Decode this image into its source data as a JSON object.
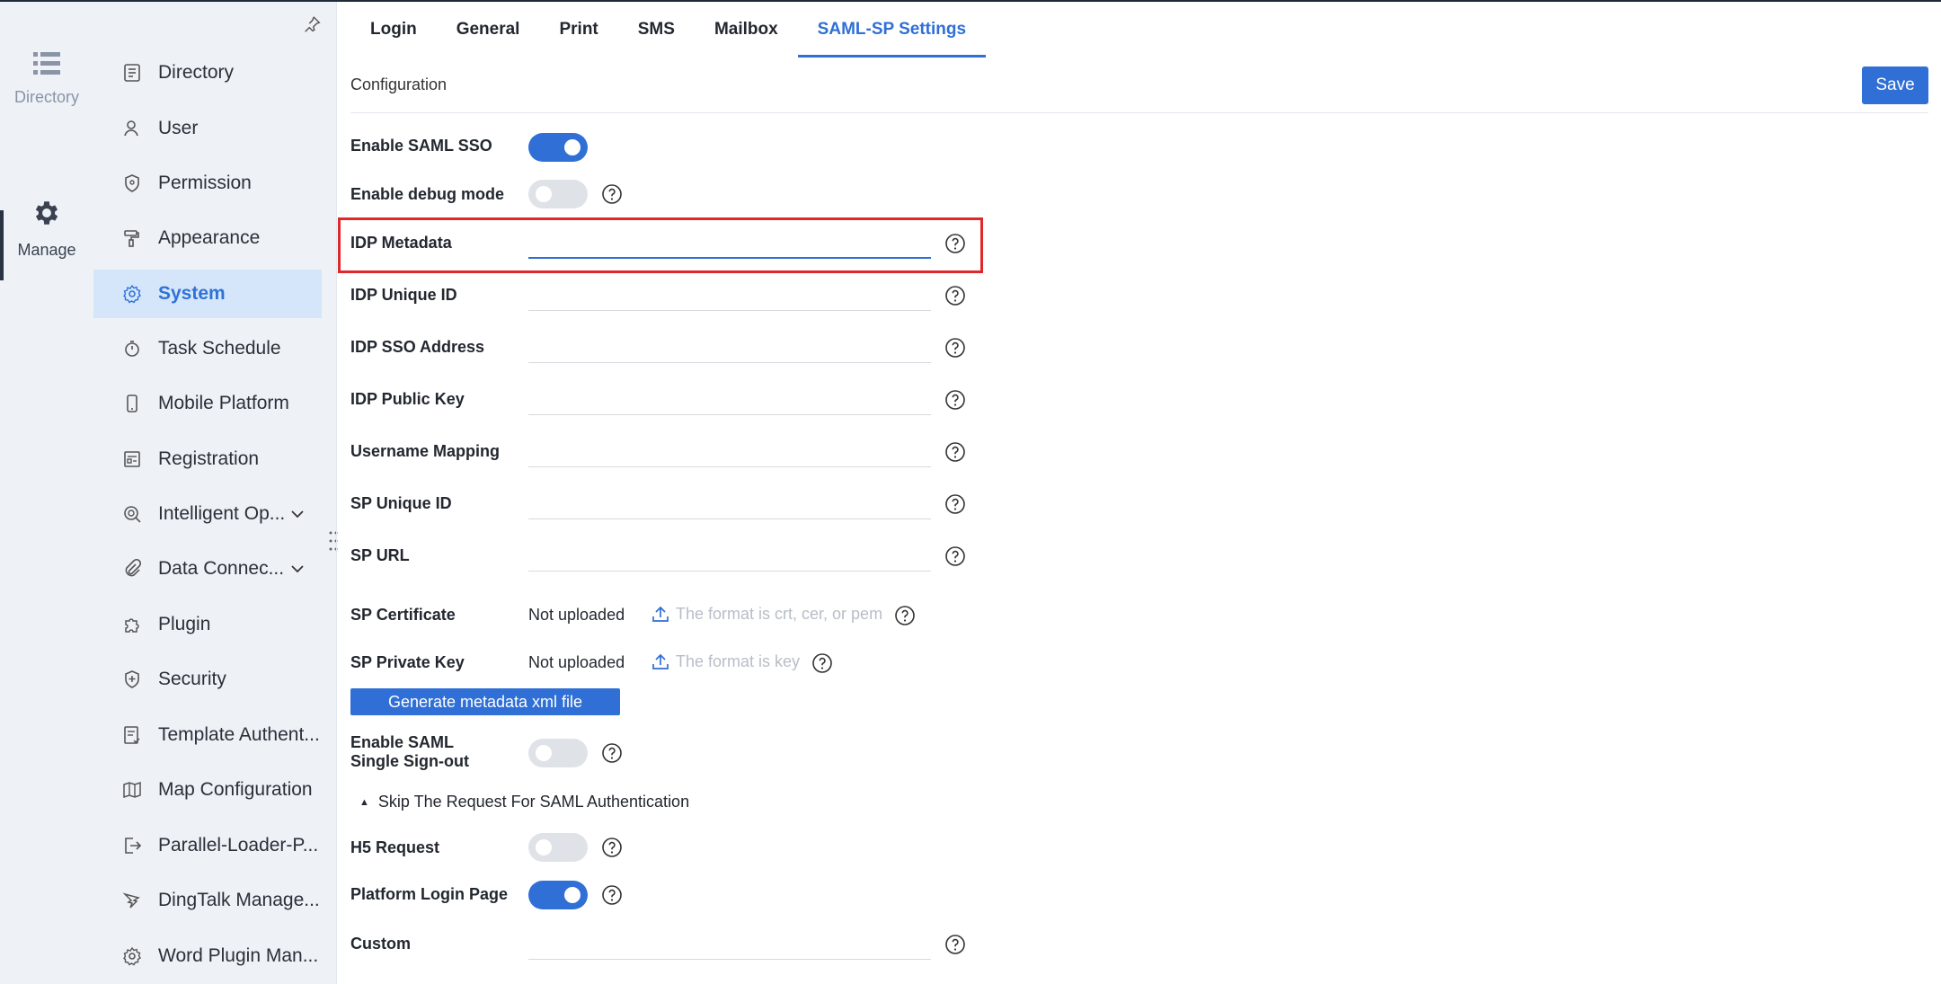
{
  "rail": {
    "items": [
      {
        "label": "Directory",
        "icon": "list-icon"
      },
      {
        "label": "Manage",
        "icon": "gear-icon"
      }
    ]
  },
  "sidebar": {
    "items": [
      {
        "label": "Directory",
        "icon": "document-list-icon"
      },
      {
        "label": "User",
        "icon": "user-icon"
      },
      {
        "label": "Permission",
        "icon": "shield-icon"
      },
      {
        "label": "Appearance",
        "icon": "paint-roller-icon"
      },
      {
        "label": "System",
        "icon": "gear-icon",
        "active": true
      },
      {
        "label": "Task Schedule",
        "icon": "stopwatch-icon"
      },
      {
        "label": "Mobile Platform",
        "icon": "mobile-icon"
      },
      {
        "label": "Registration",
        "icon": "registration-icon"
      },
      {
        "label": "Intelligent Op...",
        "icon": "intelligent-ops-icon",
        "expandable": true
      },
      {
        "label": "Data Connec...",
        "icon": "paperclip-icon",
        "expandable": true
      },
      {
        "label": "Plugin",
        "icon": "puzzle-icon"
      },
      {
        "label": "Security",
        "icon": "shield-plus-icon"
      },
      {
        "label": "Template Authent...",
        "icon": "template-icon"
      },
      {
        "label": "Map Configuration",
        "icon": "map-icon"
      },
      {
        "label": "Parallel-Loader-P...",
        "icon": "export-icon"
      },
      {
        "label": "DingTalk Manage...",
        "icon": "dingtalk-icon"
      },
      {
        "label": "Word Plugin Man...",
        "icon": "gear-icon"
      }
    ]
  },
  "tabs": [
    {
      "label": "Login"
    },
    {
      "label": "General"
    },
    {
      "label": "Print"
    },
    {
      "label": "SMS"
    },
    {
      "label": "Mailbox"
    },
    {
      "label": "SAML-SP Settings",
      "active": true
    }
  ],
  "main": {
    "section_title": "Configuration",
    "save_label": "Save",
    "enable_saml_sso": {
      "label": "Enable SAML SSO",
      "value": true
    },
    "enable_debug": {
      "label": "Enable debug mode",
      "value": false
    },
    "fields": [
      {
        "label": "IDP Metadata",
        "value": ""
      },
      {
        "label": "IDP Unique ID",
        "value": ""
      },
      {
        "label": "IDP SSO Address",
        "value": ""
      },
      {
        "label": "IDP Public Key",
        "value": ""
      },
      {
        "label": "Username Mapping",
        "value": ""
      },
      {
        "label": "SP Unique ID",
        "value": ""
      },
      {
        "label": "SP URL",
        "value": ""
      }
    ],
    "sp_certificate": {
      "label": "SP Certificate",
      "status": "Not uploaded",
      "hint": "The format is crt, cer, or pem"
    },
    "sp_private_key": {
      "label": "SP Private Key",
      "status": "Not uploaded",
      "hint": "The format is key"
    },
    "generate_label": "Generate metadata xml file",
    "single_signout": {
      "label_line1": "Enable SAML",
      "label_line2": "Single Sign-out",
      "value": false
    },
    "skip_section": "Skip The Request For SAML Authentication",
    "h5_request": {
      "label": "H5 Request",
      "value": false
    },
    "platform_login": {
      "label": "Platform Login Page",
      "value": true
    },
    "custom": {
      "label": "Custom",
      "value": ""
    }
  },
  "colors": {
    "accent": "#2f6fd6",
    "highlight": "#e0282b",
    "sidebar_bg": "#eef2f7"
  }
}
